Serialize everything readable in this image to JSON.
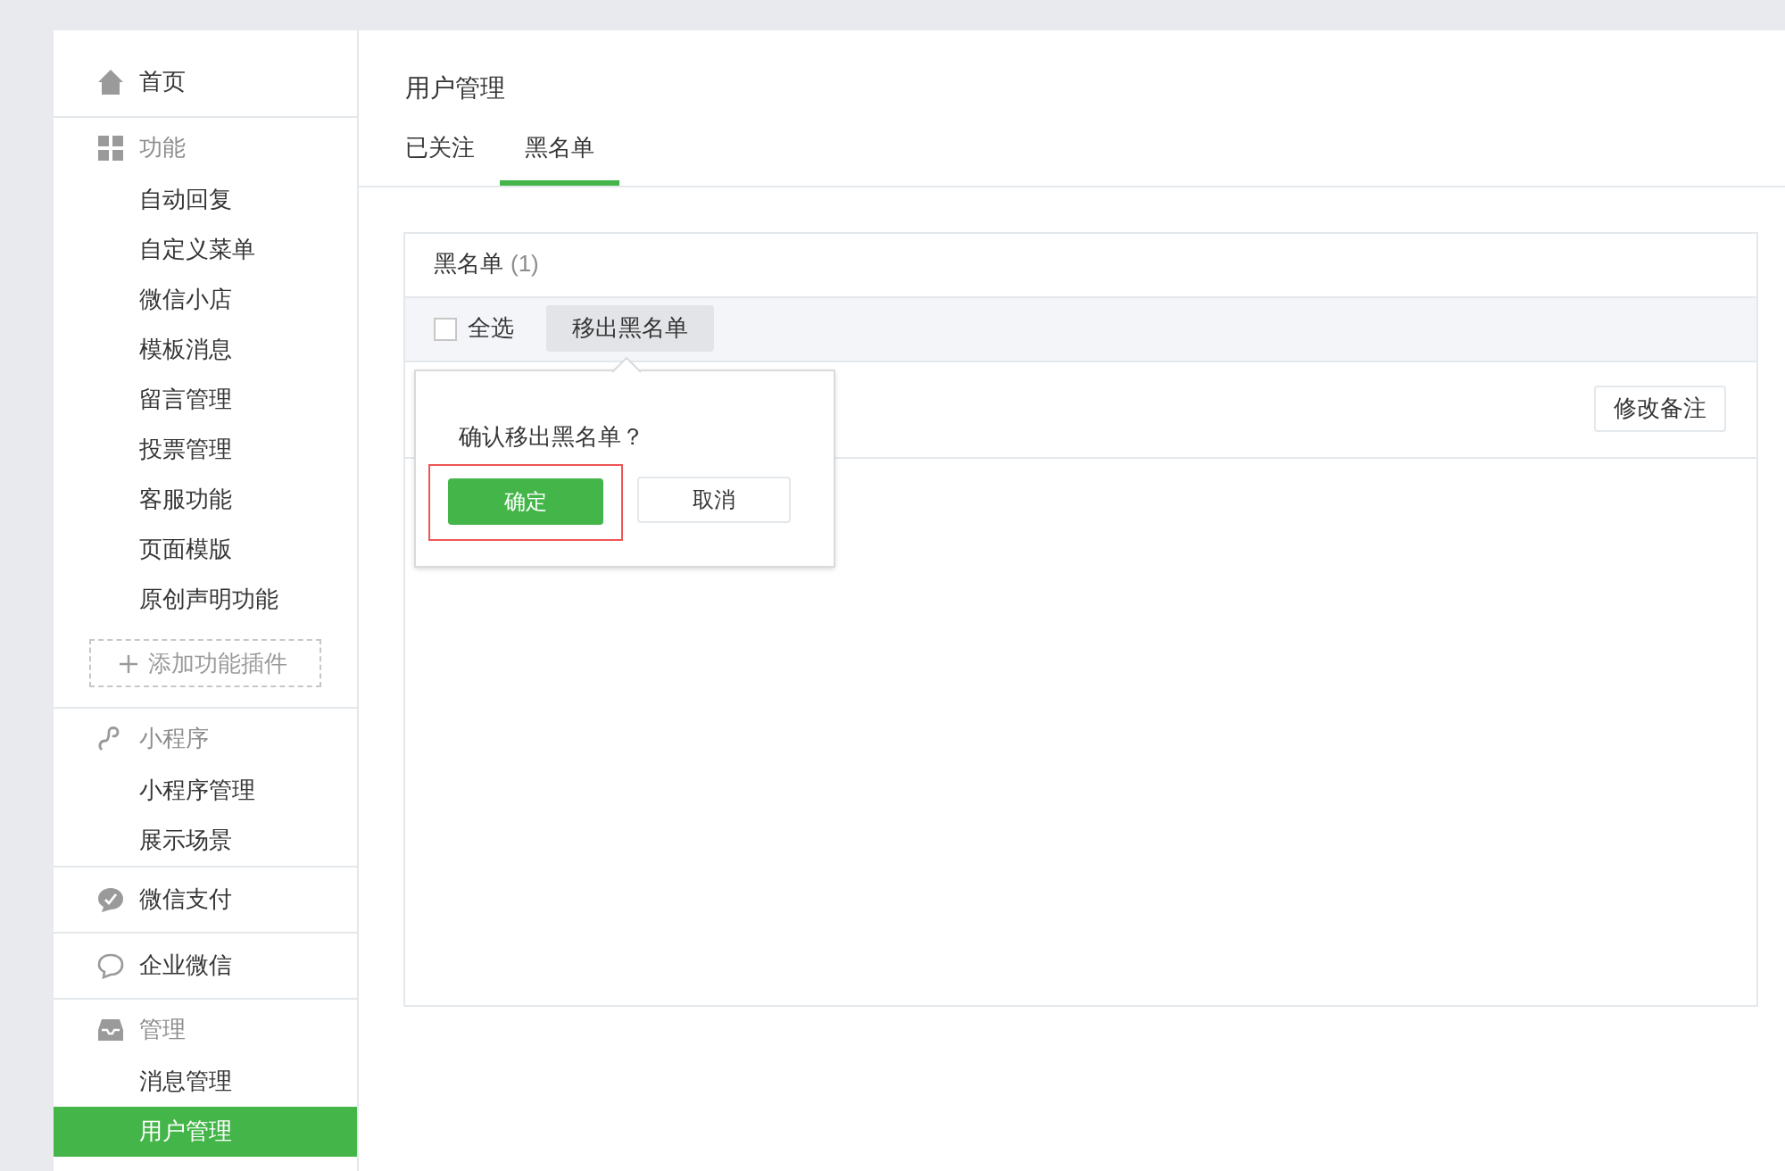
{
  "sidebar": {
    "sections": [
      {
        "kind": "link",
        "label": "首页"
      },
      {
        "kind": "group",
        "label": "功能",
        "items": [
          {
            "label": "自动回复",
            "selected": false
          },
          {
            "label": "自定义菜单",
            "selected": false
          },
          {
            "label": "微信小店",
            "selected": false
          },
          {
            "label": "模板消息",
            "selected": false
          },
          {
            "label": "留言管理",
            "selected": false
          },
          {
            "label": "投票管理",
            "selected": false
          },
          {
            "label": "客服功能",
            "selected": false
          },
          {
            "label": "页面模版",
            "selected": false
          },
          {
            "label": "原创声明功能",
            "selected": false
          }
        ],
        "add_button": "添加功能插件"
      },
      {
        "kind": "group",
        "label": "小程序",
        "items": [
          {
            "label": "小程序管理",
            "selected": false
          },
          {
            "label": "展示场景",
            "selected": false
          }
        ]
      },
      {
        "kind": "link",
        "label": "微信支付"
      },
      {
        "kind": "link",
        "label": "企业微信"
      },
      {
        "kind": "group",
        "label": "管理",
        "items": [
          {
            "label": "消息管理",
            "selected": false
          },
          {
            "label": "用户管理",
            "selected": true
          }
        ]
      }
    ]
  },
  "main": {
    "title": "用户管理",
    "tabs": [
      {
        "label": "已关注",
        "selected": false
      },
      {
        "label": "黑名单",
        "selected": true
      }
    ],
    "panel": {
      "title": "黑名单",
      "count": "(1)",
      "toolbar": {
        "select_all": {
          "label": "全选",
          "checked": false
        },
        "action": "移出黑名单"
      },
      "row": {
        "button": "修改备注"
      },
      "popover": {
        "message": "确认移出黑名单？",
        "confirm": {
          "label": "确定",
          "highlighted": true
        },
        "cancel": "取消"
      }
    }
  }
}
